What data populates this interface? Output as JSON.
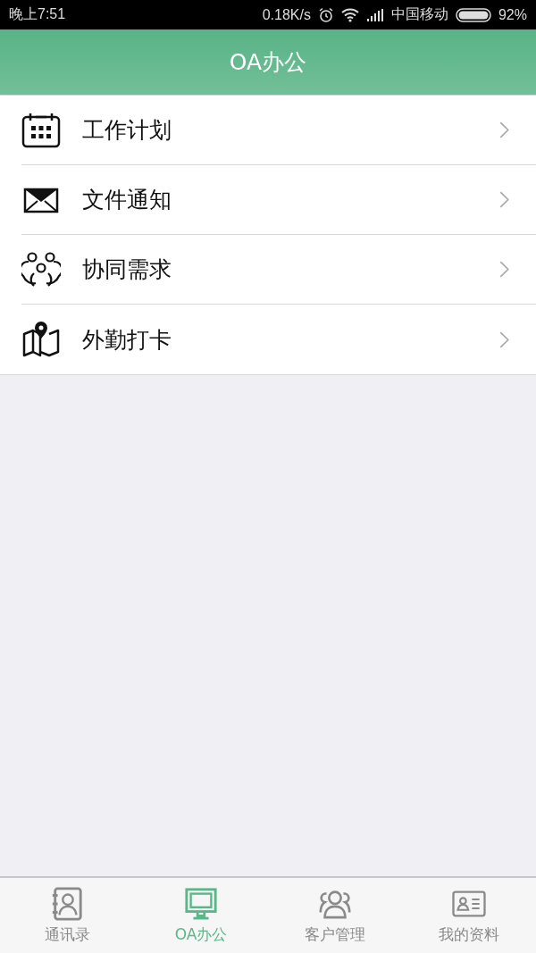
{
  "status_bar": {
    "time": "晚上7:51",
    "speed": "0.18K/s",
    "carrier": "中国移动",
    "battery": "92%"
  },
  "header": {
    "title": "OA办公"
  },
  "menu": [
    {
      "label": "工作计划"
    },
    {
      "label": "文件通知"
    },
    {
      "label": "协同需求"
    },
    {
      "label": "外勤打卡"
    }
  ],
  "tabs": [
    {
      "label": "通讯录",
      "selected": false
    },
    {
      "label": "OA办公",
      "selected": true
    },
    {
      "label": "客户管理",
      "selected": false
    },
    {
      "label": "我的资料",
      "selected": false
    }
  ]
}
